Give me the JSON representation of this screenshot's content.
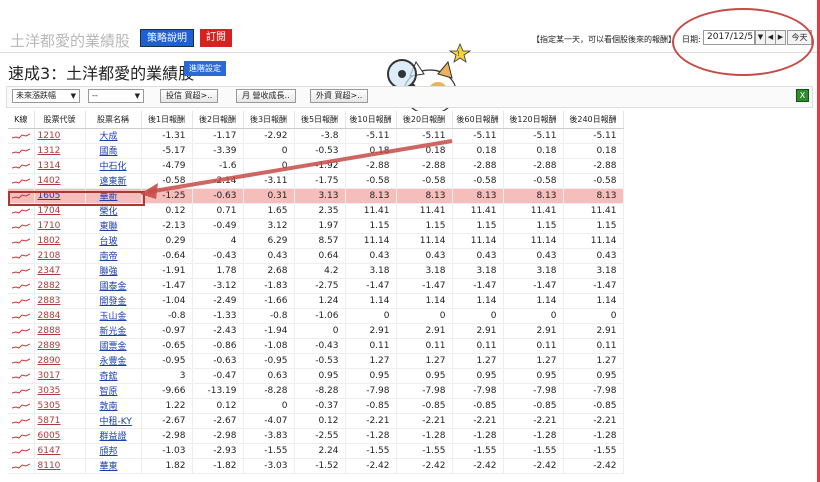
{
  "header": {
    "app_title": "土洋都愛的業績股",
    "strategy_button": "策略說明",
    "subscribe_button": "訂閱",
    "hint": "【指定某一天，可以看個股後來的報酬】",
    "date_label": "日期:",
    "date_value": "2017/12/5",
    "today_button": "今天"
  },
  "page": {
    "title": "速成3：土洋都愛的業績股",
    "settings_button": "進階設定"
  },
  "filters": {
    "sort_select": "未來漲跌幅",
    "second_select": "--",
    "buttons": [
      "投信 買超>..",
      "月 營收成長..",
      "外資 買超>.."
    ]
  },
  "icons": {
    "excel": "excel-export-icon",
    "mascot": "mascot-cat-magnifier-icon",
    "dropdown": "chevron-down-icon"
  },
  "colors": {
    "highlight_row": "#f6bdbd",
    "annotation": "#c54b47",
    "link_code": "#b03a3a",
    "link_name": "#1a3fb0"
  },
  "table": {
    "columns": [
      "K線",
      "股票代號",
      "股票名稱",
      "後1日報酬",
      "後2日報酬",
      "後3日報酬",
      "後5日報酬",
      "後10日報酬",
      "後20日報酬",
      "後60日報酬",
      "後120日報酬",
      "後240日報酬"
    ],
    "rows": [
      {
        "code": "1210",
        "name": "大成",
        "r": [
          "-1.31",
          "-1.17",
          "-2.92",
          "-3.8",
          "-5.11",
          "-5.11",
          "-5.11",
          "-5.11",
          "-5.11"
        ]
      },
      {
        "code": "1312",
        "name": "國喬",
        "r": [
          "-5.17",
          "-3.39",
          "0",
          "-0.53",
          "0.18",
          "0.18",
          "0.18",
          "0.18",
          "0.18"
        ]
      },
      {
        "code": "1314",
        "name": "中石化",
        "r": [
          "-4.79",
          "-1.6",
          "0",
          "-1.92",
          "-2.88",
          "-2.88",
          "-2.88",
          "-2.88",
          "-2.88"
        ]
      },
      {
        "code": "1402",
        "name": "遠東新",
        "r": [
          "-0.58",
          "-2.14",
          "-3.11",
          "-1.75",
          "-0.58",
          "-0.58",
          "-0.58",
          "-0.58",
          "-0.58"
        ]
      },
      {
        "code": "1605",
        "name": "華新",
        "r": [
          "-1.25",
          "-0.63",
          "0.31",
          "3.13",
          "8.13",
          "8.13",
          "8.13",
          "8.13",
          "8.13"
        ]
      },
      {
        "code": "1704",
        "name": "榮化",
        "r": [
          "0.12",
          "0.71",
          "1.65",
          "2.35",
          "11.41",
          "11.41",
          "11.41",
          "11.41",
          "11.41"
        ]
      },
      {
        "code": "1710",
        "name": "東聯",
        "r": [
          "-2.13",
          "-0.49",
          "3.12",
          "1.97",
          "1.15",
          "1.15",
          "1.15",
          "1.15",
          "1.15"
        ]
      },
      {
        "code": "1802",
        "name": "台玻",
        "r": [
          "0.29",
          "4",
          "6.29",
          "8.57",
          "11.14",
          "11.14",
          "11.14",
          "11.14",
          "11.14"
        ]
      },
      {
        "code": "2108",
        "name": "南帝",
        "r": [
          "-0.64",
          "-0.43",
          "0.43",
          "0.64",
          "0.43",
          "0.43",
          "0.43",
          "0.43",
          "0.43"
        ]
      },
      {
        "code": "2347",
        "name": "聯強",
        "r": [
          "-1.91",
          "1.78",
          "2.68",
          "4.2",
          "3.18",
          "3.18",
          "3.18",
          "3.18",
          "3.18"
        ]
      },
      {
        "code": "2882",
        "name": "國泰金",
        "r": [
          "-1.47",
          "-3.12",
          "-1.83",
          "-2.75",
          "-1.47",
          "-1.47",
          "-1.47",
          "-1.47",
          "-1.47"
        ]
      },
      {
        "code": "2883",
        "name": "開發金",
        "r": [
          "-1.04",
          "-2.49",
          "-1.66",
          "1.24",
          "1.14",
          "1.14",
          "1.14",
          "1.14",
          "1.14"
        ]
      },
      {
        "code": "2884",
        "name": "玉山金",
        "r": [
          "-0.8",
          "-1.33",
          "-0.8",
          "-1.06",
          "0",
          "0",
          "0",
          "0",
          "0"
        ]
      },
      {
        "code": "2888",
        "name": "新光金",
        "r": [
          "-0.97",
          "-2.43",
          "-1.94",
          "0",
          "2.91",
          "2.91",
          "2.91",
          "2.91",
          "2.91"
        ]
      },
      {
        "code": "2889",
        "name": "國票金",
        "r": [
          "-0.65",
          "-0.86",
          "-1.08",
          "-0.43",
          "0.11",
          "0.11",
          "0.11",
          "0.11",
          "0.11"
        ]
      },
      {
        "code": "2890",
        "name": "永豐金",
        "r": [
          "-0.95",
          "-0.63",
          "-0.95",
          "-0.53",
          "1.27",
          "1.27",
          "1.27",
          "1.27",
          "1.27"
        ]
      },
      {
        "code": "3017",
        "name": "奇鋐",
        "r": [
          "3",
          "-0.47",
          "0.63",
          "0.95",
          "0.95",
          "0.95",
          "0.95",
          "0.95",
          "0.95"
        ]
      },
      {
        "code": "3035",
        "name": "智原",
        "r": [
          "-9.66",
          "-13.19",
          "-8.28",
          "-8.28",
          "-7.98",
          "-7.98",
          "-7.98",
          "-7.98",
          "-7.98"
        ]
      },
      {
        "code": "5305",
        "name": "敦南",
        "r": [
          "1.22",
          "0.12",
          "0",
          "-0.37",
          "-0.85",
          "-0.85",
          "-0.85",
          "-0.85",
          "-0.85"
        ]
      },
      {
        "code": "5871",
        "name": "中租-KY",
        "r": [
          "-2.67",
          "-2.67",
          "-4.07",
          "0.12",
          "-2.21",
          "-2.21",
          "-2.21",
          "-2.21",
          "-2.21"
        ]
      },
      {
        "code": "6005",
        "name": "群益證",
        "r": [
          "-2.98",
          "-2.98",
          "-3.83",
          "-2.55",
          "-1.28",
          "-1.28",
          "-1.28",
          "-1.28",
          "-1.28"
        ]
      },
      {
        "code": "6147",
        "name": "頎邦",
        "r": [
          "-1.03",
          "-2.93",
          "-1.55",
          "2.24",
          "-1.55",
          "-1.55",
          "-1.55",
          "-1.55",
          "-1.55"
        ]
      },
      {
        "code": "8110",
        "name": "華東",
        "r": [
          "1.82",
          "-1.82",
          "-3.03",
          "-1.52",
          "-2.42",
          "-2.42",
          "-2.42",
          "-2.42",
          "-2.42"
        ]
      }
    ],
    "highlight_code": "1605"
  }
}
